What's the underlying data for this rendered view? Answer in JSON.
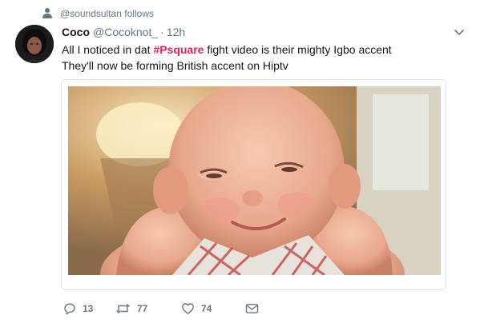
{
  "context": {
    "text": "@soundsultan follows",
    "icon": "person-icon"
  },
  "tweet": {
    "author_name": "Coco",
    "author_handle": "@Cocoknot_",
    "separator": "·",
    "time": "12h",
    "text_before_hashtag": "All I noticed in dat ",
    "hashtag": "#Psquare",
    "text_after_hashtag": " fight video is their mighty Igbo accent",
    "text_line2": "They'll now be forming British accent on Hiptv",
    "hashtag_color": "#e0245e"
  },
  "actions": {
    "reply_count": "13",
    "retweet_count": "77",
    "like_count": "74"
  },
  "colors": {
    "muted": "#657786",
    "text": "#14171a",
    "border": "#e1e8ed"
  }
}
